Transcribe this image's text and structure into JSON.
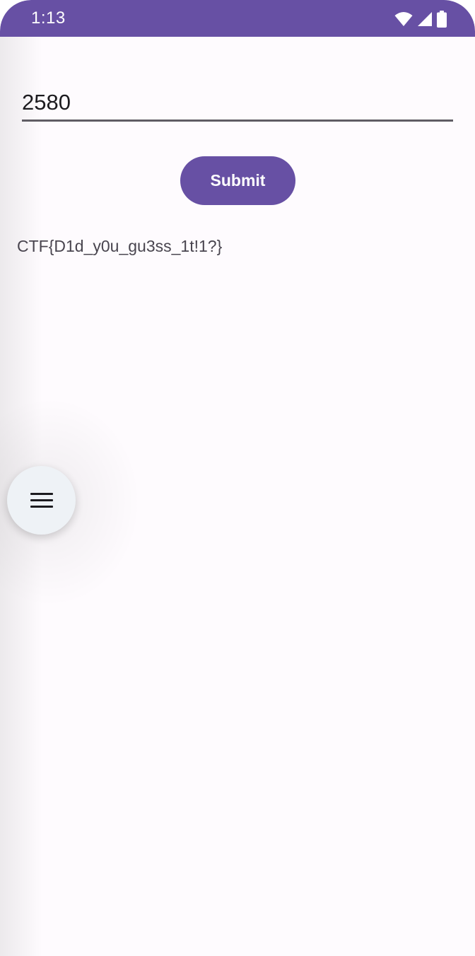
{
  "status_bar": {
    "time": "1:13",
    "icons": [
      "wifi-icon",
      "cell-signal-icon",
      "battery-icon"
    ],
    "color": "#6750a4"
  },
  "form": {
    "input_value": "2580",
    "submit_label": "Submit"
  },
  "result": {
    "text": "CTF{D1d_y0u_gu3ss_1t!1?}"
  },
  "fab": {
    "icon": "menu-icon"
  },
  "colors": {
    "accent": "#6750a4",
    "background": "#fefbfe",
    "fab_background": "#eef2f6"
  }
}
